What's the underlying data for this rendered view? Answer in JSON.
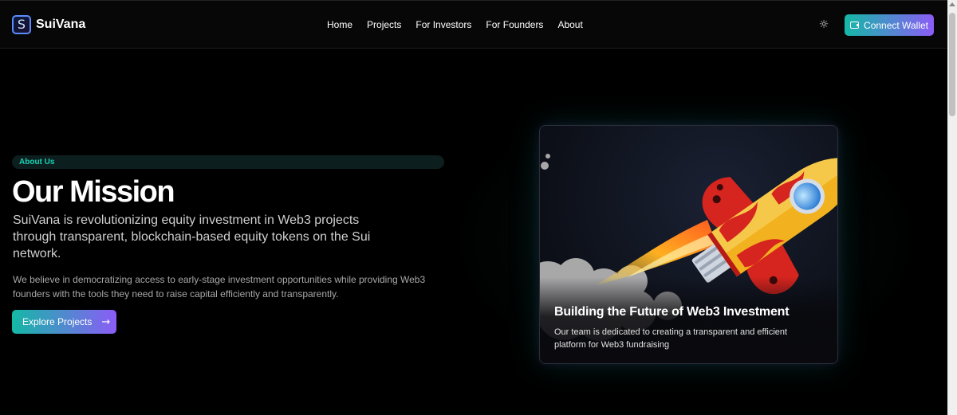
{
  "header": {
    "logo_letter": "S",
    "brand": "SuiVana",
    "nav": [
      "Home",
      "Projects",
      "For Investors",
      "For Founders",
      "About"
    ],
    "theme_icon": "sun-icon",
    "connect_wallet": "Connect Wallet"
  },
  "hero": {
    "eyebrow": "About Us",
    "title": "Our Mission",
    "lead": "SuiVana is revolutionizing equity investment in Web3 projects through transparent, blockchain-based equity tokens on the Sui network.",
    "body": "We believe in democratizing access to early-stage investment opportunities while providing Web3 founders with the tools they need to raise capital efficiently and transparently.",
    "cta": "Explore Projects",
    "cta_icon": "arrow-right-icon"
  },
  "card": {
    "image": "rocket-illustration",
    "title": "Building the Future of Web3 Investment",
    "text": "Our team is dedicated to creating a transparent and efficient platform for Web3 fundraising"
  },
  "colors": {
    "accent_start": "#14b8a6",
    "accent_end": "#8b5cf6",
    "eyebrow_text": "#19d3b5",
    "background": "#000000"
  }
}
